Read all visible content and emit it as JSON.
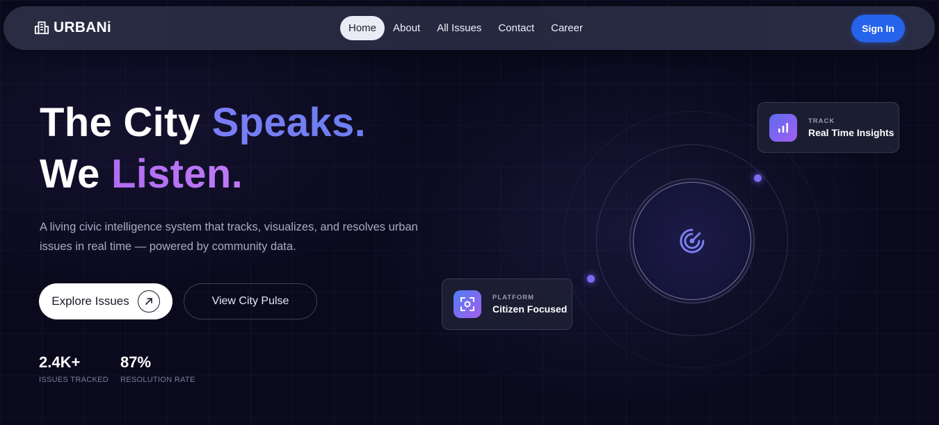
{
  "brand": {
    "name": "URBANi"
  },
  "nav": {
    "links": [
      {
        "label": "Home",
        "active": true
      },
      {
        "label": "About",
        "active": false
      },
      {
        "label": "All Issues",
        "active": false
      },
      {
        "label": "Contact",
        "active": false
      },
      {
        "label": "Career",
        "active": false
      }
    ],
    "signin_label": "Sign In"
  },
  "hero": {
    "line1_plain": "The City ",
    "line1_accent": "Speaks.",
    "line2_plain": "We ",
    "line2_accent": "Listen.",
    "subtitle": "A living civic intelligence system that tracks, visualizes, and resolves urban issues in real time — powered by community data.",
    "primary_button": "Explore Issues",
    "secondary_button": "View City Pulse"
  },
  "stats": [
    {
      "value": "2.4K+",
      "label": "ISSUES TRACKED"
    },
    {
      "value": "87%",
      "label": "RESOLUTION RATE"
    }
  ],
  "cards": {
    "track": {
      "eyebrow": "TRACK",
      "title": "Real Time Insights",
      "icon": "bar-chart-icon"
    },
    "platform": {
      "eyebrow": "PLATFORM",
      "title": "Citizen Focused",
      "icon": "scan-focus-icon"
    }
  },
  "colors": {
    "background": "#0b0a1d",
    "accent_blue": "#2563eb",
    "accent_violet": "#7b7df6",
    "accent_purple": "#b06cf2"
  },
  "icons": {
    "logo": "building-icon",
    "primary_button": "arrow-up-right-icon",
    "core": "radar-icon"
  }
}
